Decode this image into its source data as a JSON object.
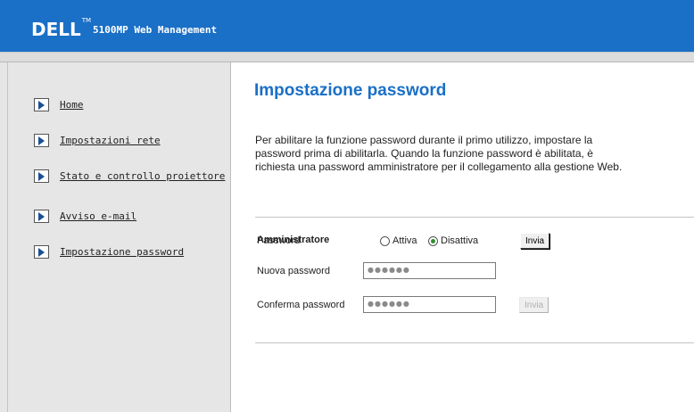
{
  "header": {
    "logo_text": "DELL",
    "trademark": "TM",
    "app_name": "5100MP Web Management"
  },
  "sidebar": {
    "items": [
      {
        "label": "Home"
      },
      {
        "label": "Impostazioni rete"
      },
      {
        "label": "Stato e controllo proiettore"
      },
      {
        "label": "Avviso e-mail"
      },
      {
        "label": "Impostazione password"
      }
    ]
  },
  "main": {
    "title": "Impostazione password",
    "description": "Per abilitare la funzione password durante il primo utilizzo, impostare la\npassword prima di abilitarla. Quando la funzione password è abilitata, è\nrichiesta una password amministratore per il collegamento alla gestione Web.",
    "section_title": "Amministratore",
    "password_label": "Password",
    "radio_on_label": "Attiva",
    "radio_off_label": "Disattiva",
    "selected": "Disattiva",
    "submit_label": "Invia",
    "new_password_label": "Nuova password",
    "new_password_value": "●●●●●●",
    "confirm_password_label": "Conferma password",
    "confirm_password_value": "●●●●●●",
    "confirm_submit_label": "Invia"
  },
  "colors": {
    "brand_blue": "#1a6fc6",
    "sidebar_bg": "#e6e6e6"
  }
}
